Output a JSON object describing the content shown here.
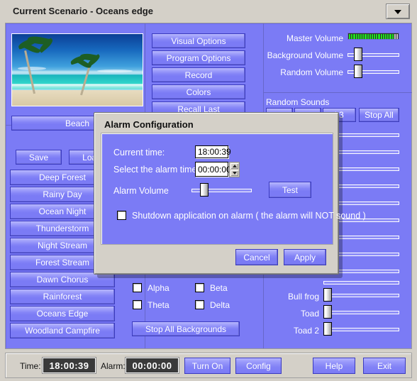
{
  "window": {
    "title": "Current Scenario - Oceans edge",
    "dropdown_icon": "chevron-down-icon"
  },
  "preview": {
    "image_alt": "beach-with-palm-trees",
    "caption": "Beach"
  },
  "file_buttons": [
    {
      "label": "Save"
    },
    {
      "label": "Load"
    }
  ],
  "scenarios": [
    {
      "label": "Deep Forest"
    },
    {
      "label": "Rainy Day"
    },
    {
      "label": "Ocean Night"
    },
    {
      "label": "Thunderstorm"
    },
    {
      "label": "Night Stream"
    },
    {
      "label": "Forest Stream"
    },
    {
      "label": "Dawn Chorus"
    },
    {
      "label": "Rainforest"
    },
    {
      "label": "Oceans Edge"
    },
    {
      "label": "Woodland Campfire"
    }
  ],
  "options_buttons": [
    {
      "label": "Visual Options"
    },
    {
      "label": "Program Options"
    },
    {
      "label": "Record"
    },
    {
      "label": "Colors"
    },
    {
      "label": "Recall Last"
    }
  ],
  "volumes": {
    "master": {
      "label": "Master Volume",
      "type": "led-meter",
      "segments": 22,
      "lit": 20
    },
    "background": {
      "label": "Background Volume",
      "value": 12
    },
    "random": {
      "label": "Random Volume",
      "value": 12
    }
  },
  "random_sounds": {
    "title": "Random Sounds",
    "buttons": [
      {
        "label": ""
      },
      {
        "label": ""
      },
      {
        "label": "k3"
      },
      {
        "label": "Stop All"
      }
    ]
  },
  "brainwave": {
    "checkboxes": [
      {
        "label": "Alpha",
        "checked": false
      },
      {
        "label": "Beta",
        "checked": false
      },
      {
        "label": "Theta",
        "checked": false
      },
      {
        "label": "Delta",
        "checked": false
      }
    ],
    "stop_all_label": "Stop All Backgrounds"
  },
  "sound_sliders": [
    {
      "label": "Bull frog",
      "value": 4
    },
    {
      "label": "Toad",
      "value": 4
    },
    {
      "label": "Toad 2",
      "value": 4
    }
  ],
  "dialog": {
    "title": "Alarm Configuration",
    "current_time_label": "Current time:",
    "current_time_value": "18:00:39",
    "alarm_time_label": "Select the alarm time",
    "alarm_time_value": "00:00:00",
    "volume_label": "Alarm Volume",
    "volume_value": 18,
    "test_label": "Test",
    "shutdown_label": "Shutdown application on alarm ( the alarm will NOT sound )",
    "shutdown_checked": false,
    "cancel_label": "Cancel",
    "apply_label": "Apply"
  },
  "statusbar": {
    "time_label": "Time:",
    "time_value": "18:00:39",
    "alarm_label": "Alarm:",
    "alarm_value": "00:00:00",
    "turn_on_label": "Turn On",
    "config_label": "Config",
    "help_label": "Help",
    "exit_label": "Exit"
  },
  "colors": {
    "panel": "#7b7bf5",
    "chrome": "#d4d0c8",
    "meter_green": "#21e21f",
    "button_border": "#3b3bbf"
  }
}
